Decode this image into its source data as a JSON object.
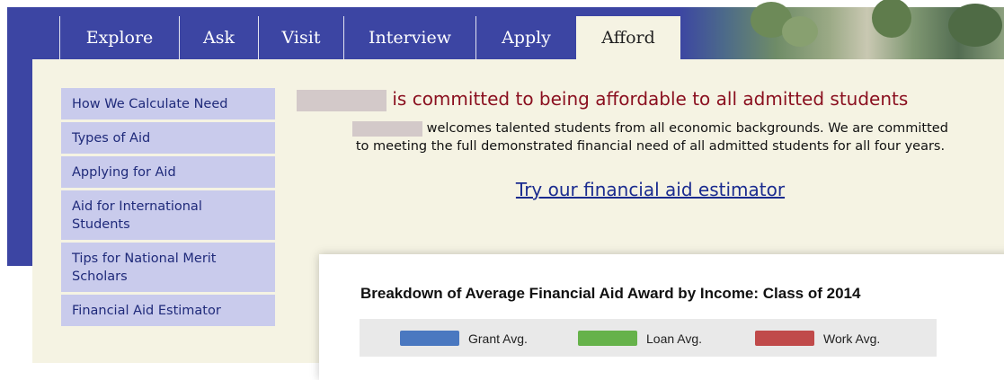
{
  "nav": {
    "tabs": [
      {
        "label": "Explore",
        "active": false
      },
      {
        "label": "Ask",
        "active": false
      },
      {
        "label": "Visit",
        "active": false
      },
      {
        "label": "Interview",
        "active": false
      },
      {
        "label": "Apply",
        "active": false
      },
      {
        "label": "Afford",
        "active": true
      }
    ]
  },
  "sidebar": {
    "items": [
      {
        "label": "How We Calculate Need"
      },
      {
        "label": "Types of Aid"
      },
      {
        "label": "Applying for Aid"
      },
      {
        "label": "Aid for International Students"
      },
      {
        "label": "Tips for National Merit Scholars"
      },
      {
        "label": "Financial Aid Estimator"
      }
    ]
  },
  "main": {
    "headline": "is committed to being affordable to all admitted students",
    "intro_line1": "welcomes talented students from all economic backgrounds. We are committed",
    "intro_line2": "to meeting the full demonstrated financial need of all admitted students for all four years.",
    "estimator_link": "Try our financial aid estimator"
  },
  "chart": {
    "title": "Breakdown of Average Financial Aid Award by Income: Class of 2014",
    "legend": [
      {
        "label": "Grant Avg.",
        "color": "#4a78c0"
      },
      {
        "label": "Loan Avg.",
        "color": "#66b24a"
      },
      {
        "label": "Work Avg.",
        "color": "#c04a4a"
      }
    ]
  },
  "colors": {
    "header_blue": "#3c45a3",
    "page_cream": "#f5f3e3",
    "sidebar_item": "#c9cbec",
    "headline_red": "#8a0f1f",
    "link_blue": "#1a2b8f"
  }
}
